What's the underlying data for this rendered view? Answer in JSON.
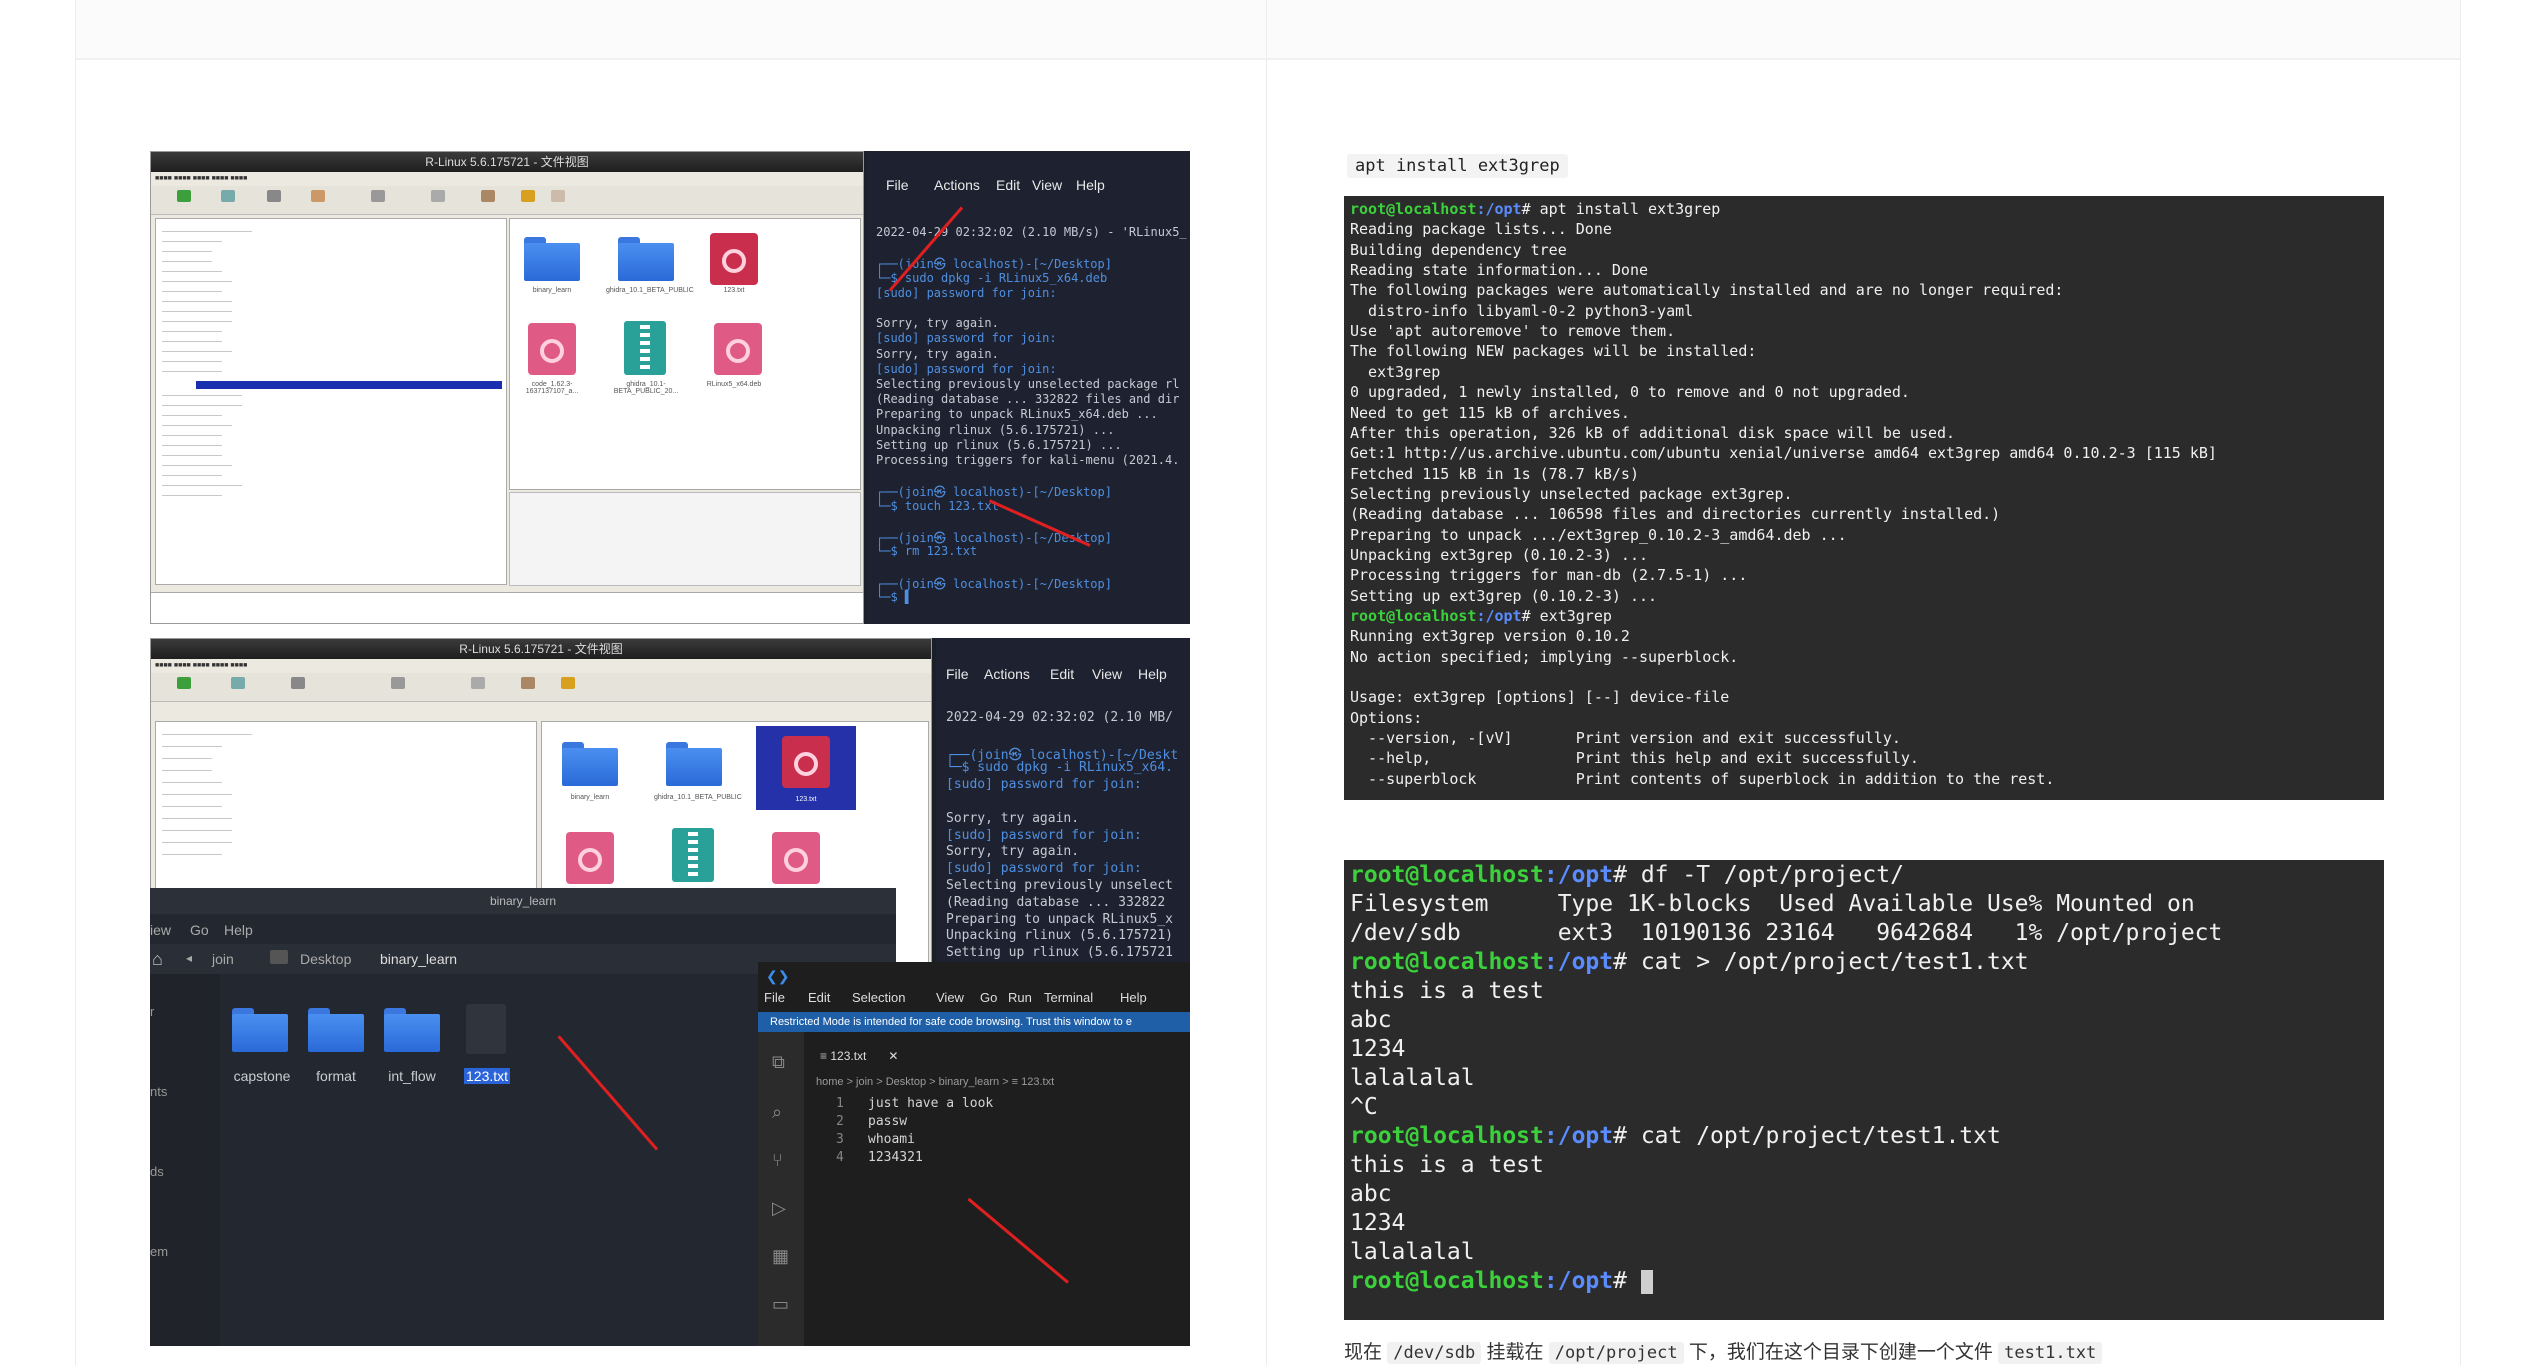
{
  "rlinux_title": "R-Linux 5.6.175721 - 文件视图",
  "rlinux_files": [
    {
      "name": "binary_learn"
    },
    {
      "name": "ghidra_10.1_BETA_PUBLIC"
    },
    {
      "name": "123.txt"
    },
    {
      "name": "code_1.62.3-1637137107_a..."
    },
    {
      "name": "ghidra_10.1-BETA_PUBLIC_20..."
    },
    {
      "name": "RLinux5_x64.deb"
    }
  ],
  "kali_term": {
    "menu": [
      "File",
      "Actions",
      "Edit",
      "View",
      "Help"
    ],
    "lines": [
      "2022-04-29 02:32:02 (2.10 MB/s) - 'RLinux5_",
      "",
      "┌──(join㉿ localhost)-[~/Desktop]",
      "└─$ sudo dpkg -i RLinux5_x64.deb",
      "[sudo] password for join:",
      "",
      "Sorry, try again.",
      "[sudo] password for join:",
      "Sorry, try again.",
      "[sudo] password for join:",
      "Selecting previously unselected package rl",
      "(Reading database ... 332822 files and dir",
      "Preparing to unpack RLinux5_x64.deb ...",
      "Unpacking rlinux (5.6.175721) ...",
      "Setting up rlinux (5.6.175721) ...",
      "Processing triggers for kali-menu (2021.4.",
      "",
      "┌──(join㉿ localhost)-[~/Desktop]",
      "└─$ touch 123.txt",
      "",
      "┌──(join㉿ localhost)-[~/Desktop]",
      "└─$ rm 123.txt",
      "",
      "┌──(join㉿ localhost)-[~/Desktop]",
      "└─$ ▌"
    ]
  },
  "kali_term2": {
    "menu": [
      "File",
      "Actions",
      "Edit",
      "View",
      "Help"
    ],
    "lines": [
      "2022-04-29 02:32:02 (2.10 MB/",
      "",
      "┌──(join㉿ localhost)-[~/Deskt",
      "└─$ sudo dpkg -i RLinux5_x64.",
      "[sudo] password for join:",
      "",
      "Sorry, try again.",
      "[sudo] password for join:",
      "Sorry, try again.",
      "[sudo] password for join:",
      "Selecting previously unselect",
      "(Reading database ... 332822",
      "Preparing to unpack RLinux5_x",
      "Unpacking rlinux (5.6.175721)",
      "Setting up rlinux (5.6.175721"
    ]
  },
  "filemanager": {
    "title": "binary_learn",
    "menu": [
      "iew",
      "Go",
      "Help"
    ],
    "breadcrumb": [
      "join",
      "Desktop",
      "binary_learn"
    ],
    "items": [
      "capstone",
      "format",
      "int_flow",
      "123.txt"
    ],
    "side_labels": [
      "r",
      "nts",
      "ds",
      "em"
    ]
  },
  "vscode": {
    "menu": [
      "File",
      "Edit",
      "Selection",
      "View",
      "Go",
      "Run",
      "Terminal",
      "Help"
    ],
    "banner": "Restricted Mode is intended for safe code browsing. Trust this window to e",
    "tab": "123.txt",
    "breadcrumb": "home > join > Desktop > binary_learn > ≡ 123.txt",
    "lines": [
      {
        "n": "1",
        "t": "just have a look"
      },
      {
        "n": "2",
        "t": "passw"
      },
      {
        "n": "3",
        "t": "whoami"
      },
      {
        "n": "4",
        "t": "1234321"
      }
    ]
  },
  "inline_cmd": "apt install ext3grep",
  "term1": {
    "lines": [
      {
        "user": "root@localhost",
        "path": ":/opt",
        "cmd": "# apt install ext3grep"
      },
      {
        "text": "Reading package lists... Done"
      },
      {
        "text": "Building dependency tree"
      },
      {
        "text": "Reading state information... Done"
      },
      {
        "text": "The following packages were automatically installed and are no longer required:"
      },
      {
        "text": "  distro-info libyaml-0-2 python3-yaml"
      },
      {
        "text": "Use 'apt autoremove' to remove them."
      },
      {
        "text": "The following NEW packages will be installed:"
      },
      {
        "text": "  ext3grep"
      },
      {
        "text": "0 upgraded, 1 newly installed, 0 to remove and 0 not upgraded."
      },
      {
        "text": "Need to get 115 kB of archives."
      },
      {
        "text": "After this operation, 326 kB of additional disk space will be used."
      },
      {
        "text": "Get:1 http://us.archive.ubuntu.com/ubuntu xenial/universe amd64 ext3grep amd64 0.10.2-3 [115 kB]"
      },
      {
        "text": "Fetched 115 kB in 1s (78.7 kB/s)"
      },
      {
        "text": "Selecting previously unselected package ext3grep."
      },
      {
        "text": "(Reading database ... 106598 files and directories currently installed.)"
      },
      {
        "text": "Preparing to unpack .../ext3grep_0.10.2-3_amd64.deb ..."
      },
      {
        "text": "Unpacking ext3grep (0.10.2-3) ..."
      },
      {
        "text": "Processing triggers for man-db (2.7.5-1) ..."
      },
      {
        "text": "Setting up ext3grep (0.10.2-3) ..."
      },
      {
        "user": "root@localhost",
        "path": ":/opt",
        "cmd": "# ext3grep"
      },
      {
        "text": "Running ext3grep version 0.10.2"
      },
      {
        "text": "No action specified; implying --superblock."
      },
      {
        "text": ""
      },
      {
        "text": "Usage: ext3grep [options] [--] device-file"
      },
      {
        "text": "Options:"
      },
      {
        "text": "  --version, -[vV]       Print version and exit successfully."
      },
      {
        "text": "  --help,                Print this help and exit successfully."
      },
      {
        "text": "  --superblock           Print contents of superblock in addition to the rest."
      }
    ]
  },
  "term2": {
    "lines": [
      {
        "user": "root@localhost",
        "path": ":/opt",
        "cmd": "# df -T /opt/project/"
      },
      {
        "text": "Filesystem     Type 1K-blocks  Used Available Use% Mounted on"
      },
      {
        "text": "/dev/sdb       ext3  10190136 23164   9642684   1% /opt/project"
      },
      {
        "user": "root@localhost",
        "path": ":/opt",
        "cmd": "# cat > /opt/project/test1.txt"
      },
      {
        "text": "this is a test"
      },
      {
        "text": "abc"
      },
      {
        "text": "1234"
      },
      {
        "text": "lalalalal"
      },
      {
        "text": "^C"
      },
      {
        "user": "root@localhost",
        "path": ":/opt",
        "cmd": "# cat /opt/project/test1.txt"
      },
      {
        "text": "this is a test"
      },
      {
        "text": "abc"
      },
      {
        "text": "1234"
      },
      {
        "text": "lalalalal"
      },
      {
        "user": "root@localhost",
        "path": ":/opt",
        "cmd": "# "
      }
    ]
  },
  "caption": {
    "p1": "现在",
    "c1": "/dev/sdb",
    "p2": "挂载在",
    "c2": "/opt/project",
    "p3": "下，我们在这个目录下创建一个文件",
    "c3": "test1.txt"
  }
}
